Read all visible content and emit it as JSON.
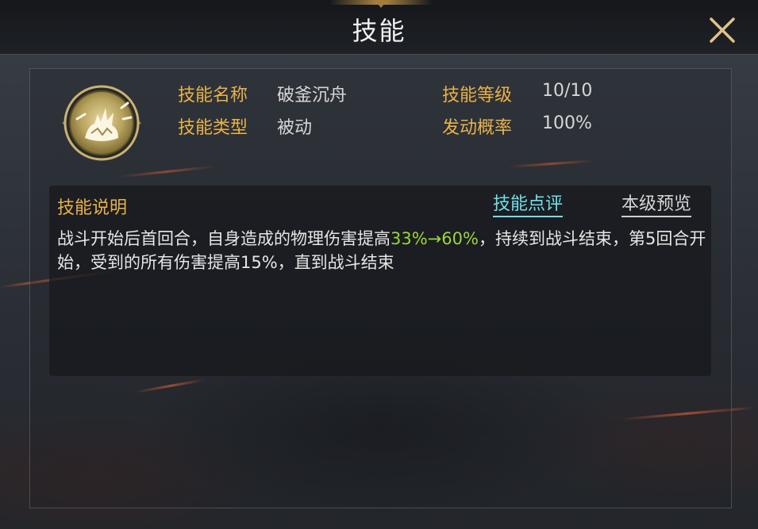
{
  "window": {
    "title": "技能"
  },
  "skill": {
    "icon": "shattered-cauldron-emblem-icon",
    "fields": [
      {
        "label": "技能名称",
        "value": "破釜沉舟"
      },
      {
        "label": "技能等级",
        "value": "10/10"
      },
      {
        "label": "技能类型",
        "value": "被动"
      },
      {
        "label": "发动概率",
        "value": "100%"
      }
    ]
  },
  "description": {
    "heading": "技能说明",
    "tabs": {
      "review": "技能点评",
      "preview": "本级预览"
    },
    "text_part1": "战斗开始后首回合，自身造成的物理伤害提高",
    "highlight": "33%→60%",
    "text_part2": "，持续到战斗结束，第5回合开始，受到的所有伤害提高15%，直到战斗结束"
  },
  "colors": {
    "label_gold": "#e8b24a",
    "highlight_green": "#9bd63b",
    "active_tab_cyan": "#6fe0e8"
  }
}
